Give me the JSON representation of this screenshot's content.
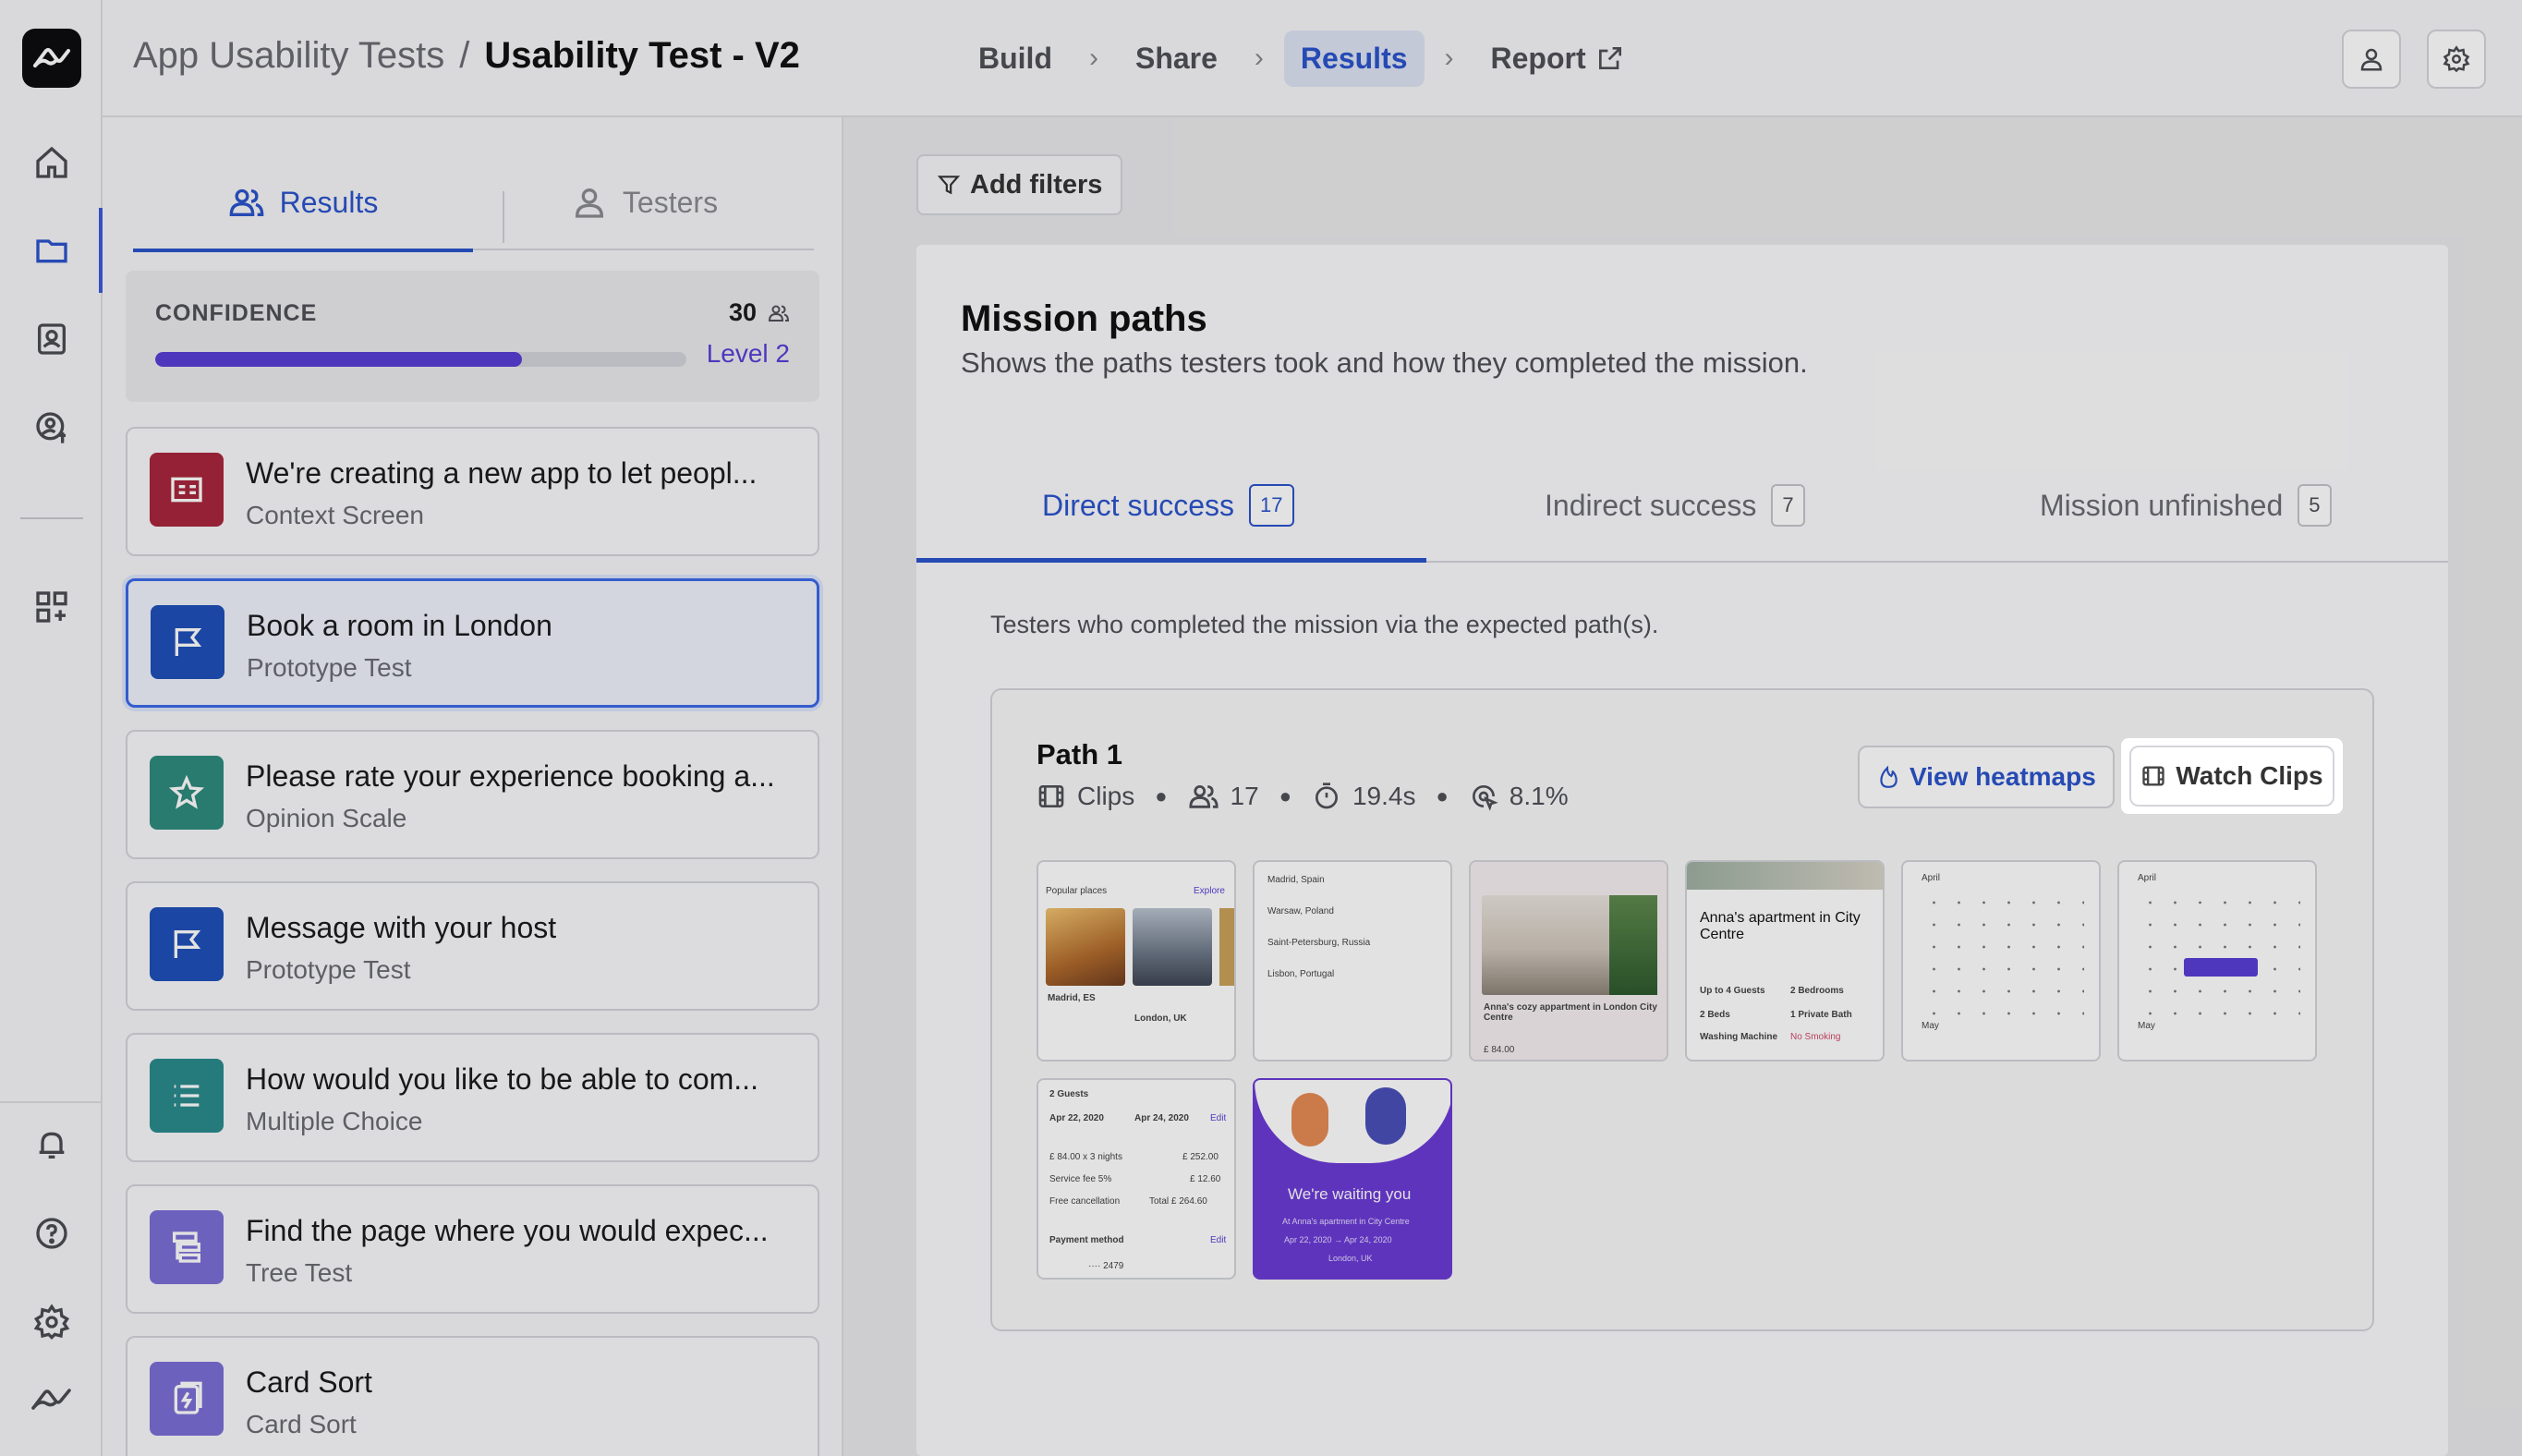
{
  "breadcrumb": {
    "parent": "App Usability Tests",
    "separator": "/",
    "current": "Usability Test - V2"
  },
  "steps": [
    {
      "label": "Build"
    },
    {
      "label": "Share"
    },
    {
      "label": "Results",
      "active": true
    },
    {
      "label": "Report"
    }
  ],
  "sidebar_tabs": {
    "results": "Results",
    "testers": "Testers"
  },
  "confidence": {
    "label": "CONFIDENCE",
    "count": "30",
    "level": "Level 2",
    "progress": 0.69
  },
  "blocks": [
    {
      "title": "We're creating a new app to let peopl...",
      "type": "Context Screen",
      "color": "#a8263c",
      "icon": "context-screen-icon"
    },
    {
      "title": "Book a room in London",
      "type": "Prototype Test",
      "color": "#1f4fb8",
      "icon": "flag-icon",
      "selected": true
    },
    {
      "title": "Please rate your experience booking a...",
      "type": "Opinion Scale",
      "color": "#2f8a7e",
      "icon": "star-icon"
    },
    {
      "title": "Message with your host",
      "type": "Prototype Test",
      "color": "#1f4fb8",
      "icon": "flag-icon"
    },
    {
      "title": "How would you like to be able to com...",
      "type": "Multiple Choice",
      "color": "#2a8a8c",
      "icon": "list-icon"
    },
    {
      "title": "Find the page where you would expec...",
      "type": "Tree Test",
      "color": "#7a6fd6",
      "icon": "tree-icon"
    },
    {
      "title": "Card Sort",
      "type": "Card Sort",
      "color": "#7a6fd6",
      "icon": "card-sort-icon"
    }
  ],
  "add_filters": "Add filters",
  "mission": {
    "title": "Mission paths",
    "subtitle": "Shows the paths testers took and how they completed the mission.",
    "tabs": [
      {
        "label": "Direct success",
        "count": "17"
      },
      {
        "label": "Indirect success",
        "count": "7"
      },
      {
        "label": "Mission unfinished",
        "count": "5"
      }
    ],
    "description": "Testers who completed the mission via the expected path(s)."
  },
  "path": {
    "title": "Path 1",
    "clips": "Clips",
    "testers": "17",
    "time": "19.4s",
    "misclick": "8.1%",
    "view_heatmaps": "View heatmaps",
    "watch_clips": "Watch Clips"
  },
  "screens": {
    "s1": {
      "header": "Popular places",
      "link": "Explore",
      "city1": "Madrid, ES",
      "city2": "London, UK"
    },
    "s2": {
      "items": [
        "Madrid, Spain",
        "Warsaw, Poland",
        "Saint-Petersburg, Russia",
        "Lisbon, Portugal"
      ]
    },
    "s3": {
      "caption": "Anna's cozy appartment in London City Centre",
      "price": "£ 84.00"
    },
    "s4": {
      "title": "Anna's apartment in City Centre",
      "g": "Up to 4 Guests",
      "b": "2 Bedrooms",
      "beds": "2 Beds",
      "bath": "1 Private Bath",
      "wash": "Washing Machine",
      "smoke": "No Smoking"
    },
    "s5": {
      "month": "April",
      "month2": "May"
    },
    "s6": {
      "month": "April",
      "month2": "May"
    },
    "s7": {
      "guests": "2 Guests",
      "from": "Apr 22, 2020",
      "to": "Apr 24, 2020",
      "edit": "Edit",
      "row1": "£ 84.00 x 3 nights",
      "v1": "£ 252.00",
      "row2": "Service fee 5%",
      "v2": "£ 12.60",
      "row3": "Free cancellation",
      "v3": "Total  £ 264.60",
      "pay": "Payment method",
      "card": "···· 2479"
    },
    "s8": {
      "title": "We're waiting you",
      "line1": "At Anna's apartment in City Centre",
      "line2": "Apr 22, 2020  →  Apr 24, 2020",
      "line3": "London, UK"
    }
  },
  "colors": {
    "accent": "#2b54cc",
    "purple": "#5a3fd6"
  }
}
